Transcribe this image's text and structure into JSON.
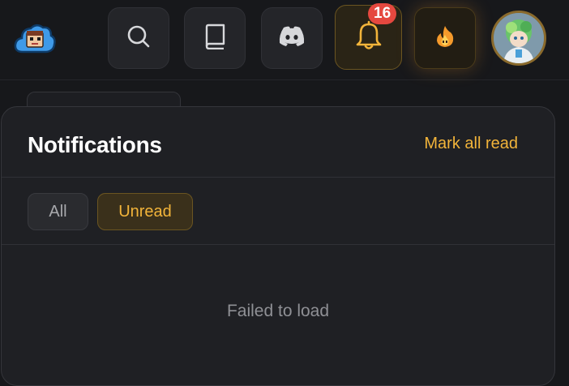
{
  "topbar": {
    "logo_icon": "cloud-mascot-icon",
    "nav": [
      {
        "name": "search",
        "icon": "search-icon"
      },
      {
        "name": "docs",
        "icon": "book-icon"
      },
      {
        "name": "discord",
        "icon": "discord-icon"
      },
      {
        "name": "notifications",
        "icon": "bell-icon",
        "badge": "16",
        "active": true
      },
      {
        "name": "streak",
        "icon": "fire-icon"
      }
    ],
    "avatar_icon": "user-avatar"
  },
  "notifications": {
    "title": "Notifications",
    "mark_all_read": "Mark all read",
    "tabs": [
      {
        "label": "All",
        "selected": false
      },
      {
        "label": "Unread",
        "selected": true
      }
    ],
    "empty_message": "Failed to load"
  },
  "colors": {
    "accent": "#f2b43a",
    "badge": "#e5483f",
    "background": "#17181b",
    "panel": "#1f2024"
  }
}
